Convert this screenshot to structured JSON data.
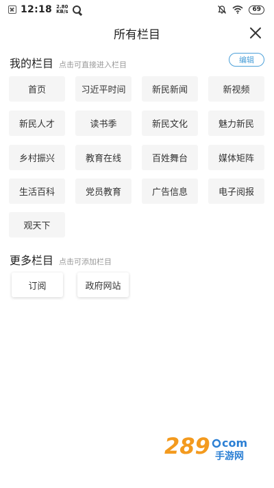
{
  "status_bar": {
    "time": "12:18",
    "speed_value": "2.80",
    "speed_unit": "KB/s",
    "battery": "69"
  },
  "header": {
    "title": "所有栏目"
  },
  "my_channels": {
    "title": "我的栏目",
    "hint": "点击可直接进入栏目",
    "edit_label": "编辑",
    "items": [
      "首页",
      "习近平时间",
      "新民新闻",
      "新视频",
      "新民人才",
      "读书季",
      "新民文化",
      "魅力新民",
      "乡村振兴",
      "教育在线",
      "百姓舞台",
      "媒体矩阵",
      "生活百科",
      "党员教育",
      "广告信息",
      "电子阅报",
      "观天下"
    ]
  },
  "more_channels": {
    "title": "更多栏目",
    "hint": "点击可添加栏目",
    "items": [
      "订阅",
      "政府网站"
    ]
  },
  "colors": {
    "accent": "#4a9fd8",
    "chip_bg": "#f5f5f5",
    "watermark_orange": "#f39a1e",
    "watermark_blue": "#2b7fd4"
  },
  "watermark": {
    "number": "289",
    "domain": "com",
    "brand": "手游网"
  }
}
